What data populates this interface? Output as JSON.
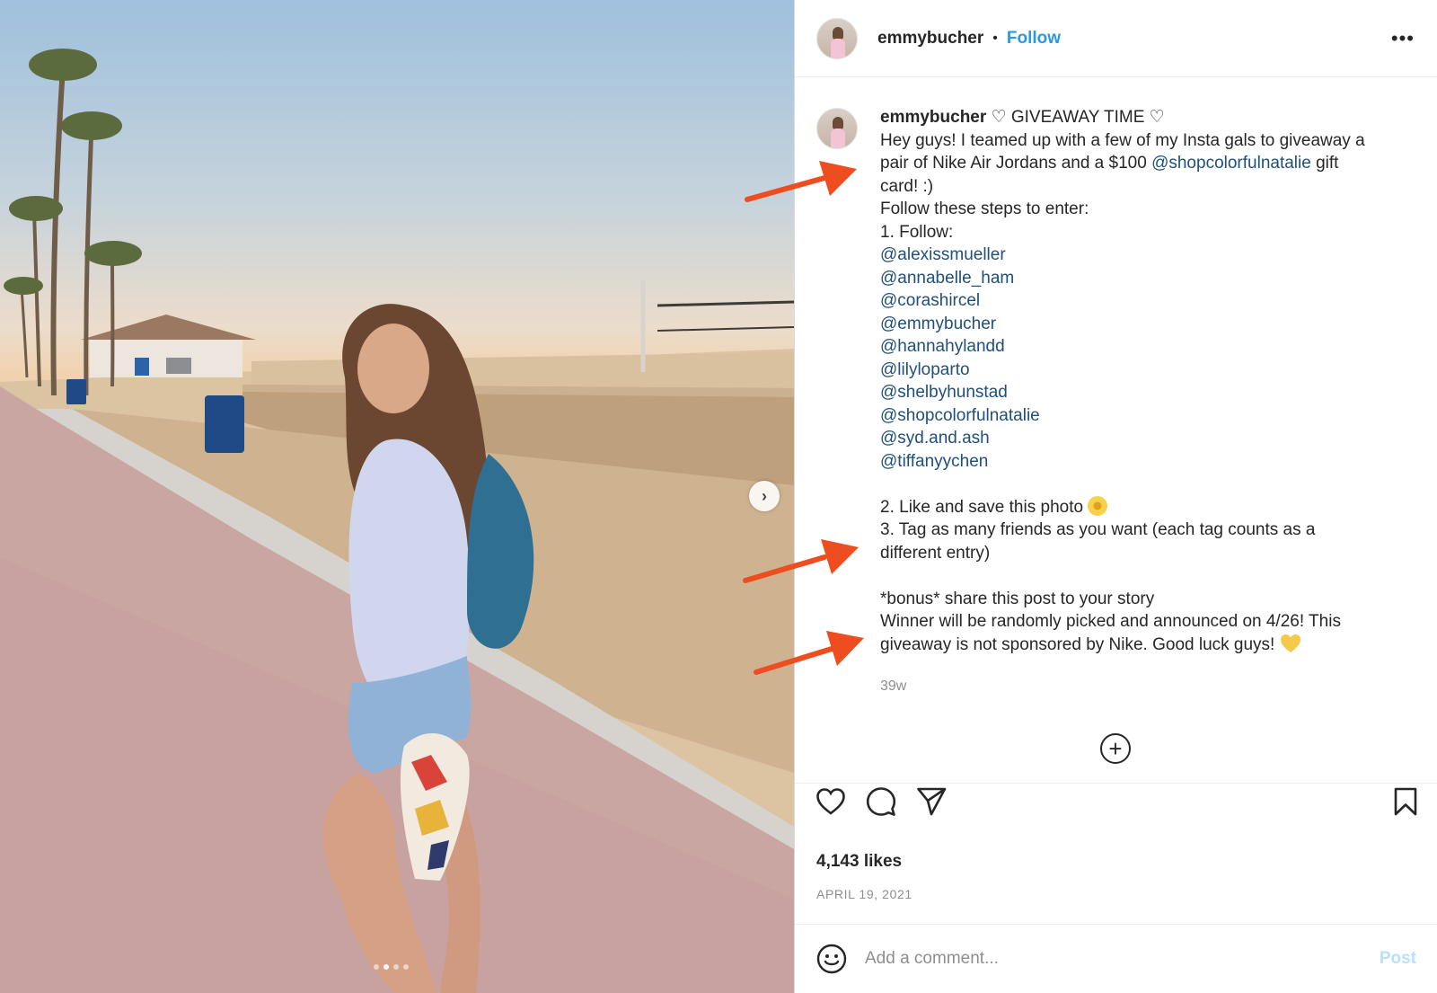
{
  "header": {
    "username": "emmybucher",
    "separator": "•",
    "follow_label": "Follow",
    "more_label": "•••"
  },
  "caption": {
    "username": "emmybucher",
    "title": "♡ GIVEAWAY TIME ♡",
    "line1": "Hey guys! I teamed up with a few of my Insta gals to giveaway a",
    "line2_pre": "pair of Nike Air Jordans and a $100 ",
    "line2_mention": "@shopcolorfulnatalie",
    "line2_post": " gift",
    "line3": "card! :)",
    "line4": "Follow these steps to enter:",
    "line5": "1. Follow:",
    "mentions": [
      "@alexissmueller",
      "@annabelle_ham",
      "@corashircel",
      "@emmybucher",
      "@hannahylandd",
      "@lilyloparto",
      "@shelbyhunstad",
      "@shopcolorfulnatalie",
      "@syd.and.ash",
      "@tiffanyychen"
    ],
    "step2": "2. Like and save this photo",
    "step3_a": "3. Tag as many friends as you want (each tag counts as a",
    "step3_b": "different entry)",
    "bonus": "*bonus* share this post to your story",
    "winner_a": "Winner will be randomly picked and announced on 4/26! This",
    "winner_b": "giveaway is not sponsored by Nike. Good luck guys!",
    "emoji_flower": "sunflower-emoji",
    "emoji_heart": "yellow-heart-emoji"
  },
  "timestamp": "39w",
  "load_more_label": "+",
  "likes": "4,143 likes",
  "date": "APRIL 19, 2021",
  "comment": {
    "placeholder": "Add a comment...",
    "post_label": "Post"
  },
  "carousel": {
    "next_label": "›",
    "total": 4,
    "current_index": 1
  },
  "colors": {
    "follow": "#2a98e6",
    "mention": "#1f4f7a",
    "annotation_arrow": "#ee4d1f",
    "post_disabled": "#b9dffc"
  },
  "icons": [
    "heart-icon",
    "comment-icon",
    "share-icon",
    "bookmark-icon",
    "emoji-icon",
    "more-icon",
    "chevron-right-icon",
    "plus-circle-icon"
  ]
}
